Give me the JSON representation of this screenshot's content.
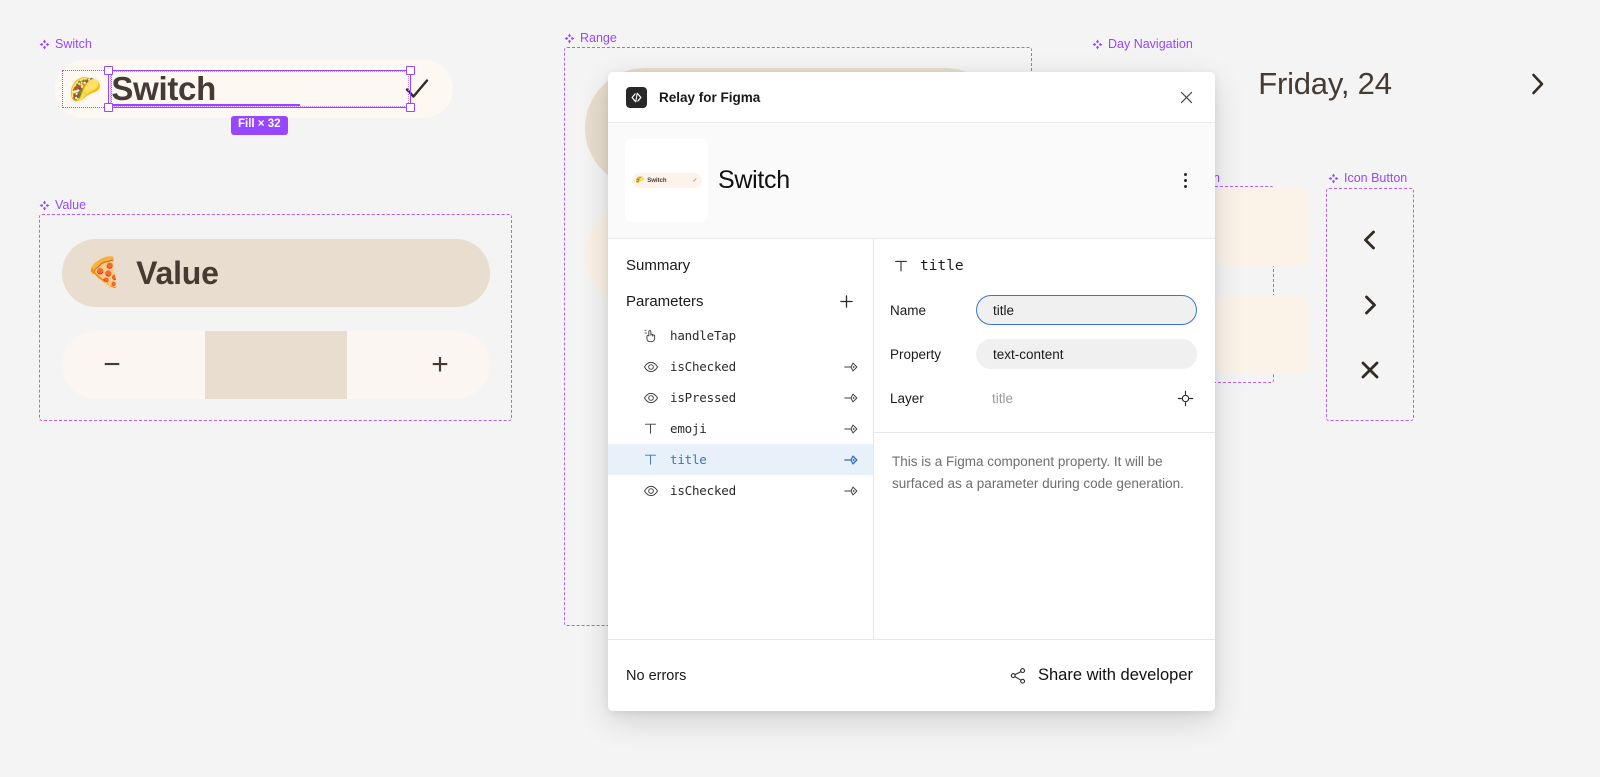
{
  "canvas": {
    "background_color": "#F4F4F4",
    "component_frames": [
      {
        "name": "switch",
        "label": "Switch"
      },
      {
        "name": "value",
        "label": "Value"
      },
      {
        "name": "range",
        "label": "Range"
      },
      {
        "name": "day-navigation",
        "label": "Day Navigation"
      },
      {
        "name": "button-partial",
        "label": "on"
      },
      {
        "name": "icon-button",
        "label": "Icon Button"
      }
    ],
    "accent_color": "#9747FF"
  },
  "switch_component": {
    "emoji": "🌮",
    "emoji_name": "taco-emoji",
    "title": "Switch",
    "check_icon": "check-icon",
    "fill_badge": "Fill × 32",
    "badge_color": "#9747FF",
    "pill_color": "#FDF8F2",
    "text_color": "#463A32"
  },
  "value_component": {
    "emoji": "🍕",
    "emoji_name": "pizza-emoji",
    "label": "Value",
    "pill_color": "#E8DDCE",
    "stepper": {
      "decrement": "−",
      "increment": "+",
      "track_color": "#FBF6F1",
      "field_color": "#E8DDCE"
    }
  },
  "day_navigation": {
    "prev_icon": "chevron-left-icon",
    "label": "Friday, 24",
    "next_icon": "chevron-right-icon"
  },
  "icon_button_stack": {
    "buttons": [
      {
        "icon": "chevron-left-icon"
      },
      {
        "icon": "chevron-right-icon"
      },
      {
        "icon": "close-x-icon"
      }
    ]
  },
  "dialog": {
    "titlebar": {
      "logo_icon": "code-brackets-icon",
      "title": "Relay for Figma",
      "close_icon": "close-icon"
    },
    "component_header": {
      "thumbnail": {
        "emoji": "🌮",
        "label": "Switch",
        "check": "✓"
      },
      "name": "Switch",
      "menu_icon": "kebab-menu-icon"
    },
    "left_panel": {
      "summary_label": "Summary",
      "parameters_label": "Parameters",
      "add_icon": "plus-icon",
      "parameters": [
        {
          "icon": "tap-gesture-icon",
          "name": "handleTap",
          "has_link": false,
          "selected": false
        },
        {
          "icon": "eye-icon",
          "name": "isChecked",
          "has_link": true,
          "selected": false
        },
        {
          "icon": "eye-icon",
          "name": "isPressed",
          "has_link": true,
          "selected": false
        },
        {
          "icon": "text-type-icon",
          "name": "emoji",
          "has_link": true,
          "selected": false
        },
        {
          "icon": "text-type-icon",
          "name": "title",
          "has_link": true,
          "selected": true
        },
        {
          "icon": "eye-icon",
          "name": "isChecked",
          "has_link": true,
          "selected": false
        }
      ],
      "selected_highlight_color": "#E8F0FA",
      "selected_text_color": "#3A76C4"
    },
    "right_panel": {
      "header_icon": "text-type-icon",
      "header_name": "title",
      "fields": [
        {
          "label": "Name",
          "value": "title",
          "focused": true,
          "type": "input"
        },
        {
          "label": "Property",
          "value": "text-content",
          "focused": false,
          "type": "input"
        },
        {
          "label": "Layer",
          "value": "title",
          "focused": false,
          "type": "plain",
          "action_icon": "target-crosshair-icon"
        }
      ],
      "description": "This is a Figma component property. It will be surfaced as a parameter during code generation."
    },
    "footer": {
      "status": "No errors",
      "share_icon": "share-nodes-icon",
      "share_label": "Share with developer"
    }
  }
}
